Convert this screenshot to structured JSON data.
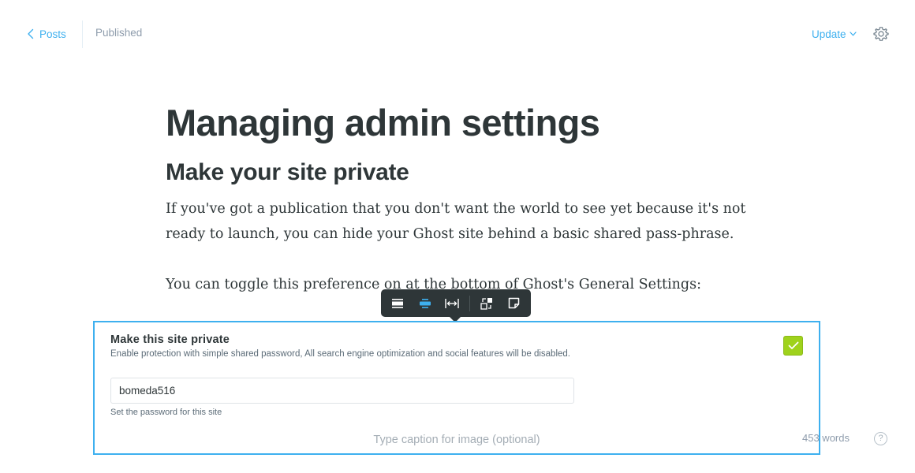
{
  "header": {
    "back_label": "Posts",
    "status": "Published",
    "update_label": "Update"
  },
  "post": {
    "title": "Managing admin settings",
    "heading": "Make your site private",
    "paragraph_1": "If you've got a publication that you don't want the world to see yet because it's not ready to launch, you can hide your Ghost site behind a basic shared pass-phrase.",
    "paragraph_2": "You can toggle this preference on at the bottom of Ghost's General Settings:"
  },
  "card_toolbar": {
    "buttons": [
      "full-width-icon",
      "normal-width-icon",
      "wide-width-icon",
      "replace-image-icon",
      "snippet-icon"
    ]
  },
  "image_card": {
    "screenshot": {
      "title": "Make this site private",
      "description": "Enable protection with simple shared password, All search engine optimization and social features will be disabled.",
      "password_value": "bomeda516",
      "password_hint": "Set the password for this site",
      "checked": true
    },
    "caption_placeholder": "Type caption for image (optional)"
  },
  "footer": {
    "word_count": "453 words",
    "help_label": "?"
  },
  "colors": {
    "accent": "#3eb0ef",
    "dark": "#2e3638",
    "check_green": "#9fd21c"
  }
}
